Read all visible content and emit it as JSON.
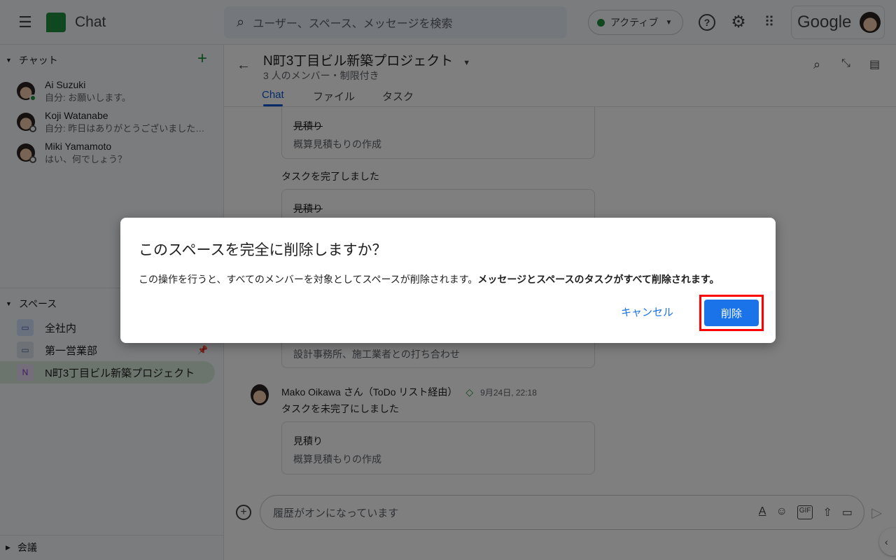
{
  "app": {
    "title": "Chat",
    "brand_color": "#1e8e3e"
  },
  "search": {
    "placeholder": "ユーザー、スペース、メッセージを検索"
  },
  "status": {
    "label": "アクティブ",
    "color": "#1e8e3e"
  },
  "account": {
    "logo_text": "Google"
  },
  "sidebar": {
    "chat_section": "チャット",
    "chats": [
      {
        "name": "Ai Suzuki",
        "preview": "自分: お願いします。",
        "presence": "active"
      },
      {
        "name": "Koji Watanabe",
        "preview": "自分: 昨日はありがとうございました…",
        "presence": "away"
      },
      {
        "name": "Miki Yamamoto",
        "preview": "はい、何でしょう？",
        "presence": "away"
      }
    ],
    "spaces_section": "スペース",
    "spaces": [
      {
        "name": "全社内",
        "icon": "space-icon"
      },
      {
        "name": "第一営業部",
        "icon": "space-icon",
        "pinned": true
      },
      {
        "name": "N町3丁目ビル新築プロジェクト",
        "icon_letter": "N",
        "selected": true
      }
    ],
    "meetings_section": "会議"
  },
  "space": {
    "title": "N町3丁目ビル新築プロジェクト",
    "subtitle": "3 人のメンバー・制限付き",
    "tabs": [
      "Chat",
      "ファイル",
      "タスク"
    ],
    "active_tab": "Chat"
  },
  "messages": {
    "card1": {
      "title": "見積り",
      "desc": "概算見積もりの作成",
      "completed": true
    },
    "text1": "タスクを完了しました",
    "card2": {
      "title": "見積り",
      "completed": true
    },
    "card3": {
      "desc": "設計事務所、施工業者との打ち合わせ"
    },
    "msg": {
      "author": "Mako Oikawa",
      "suffix": "さん（ToDo リスト経由）",
      "time": "9月24日, 22:18",
      "text": "タスクを未完了にしました"
    },
    "card4": {
      "title": "見積り",
      "desc": "概算見積もりの作成",
      "completed": false
    }
  },
  "composer": {
    "placeholder": "履歴がオンになっています"
  },
  "dialog": {
    "title": "このスペースを完全に削除しますか？",
    "body": "この操作を行うと、すべてのメンバーを対象としてスペースが削除されます。",
    "body_bold": "メッセージとスペースのタスクがすべて削除されます。",
    "cancel": "キャンセル",
    "delete": "削除"
  }
}
